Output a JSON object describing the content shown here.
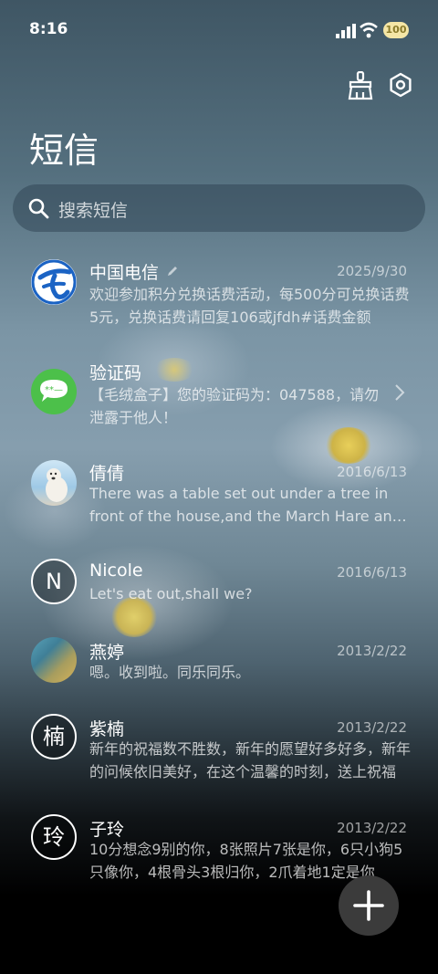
{
  "status": {
    "time": "8:16",
    "battery": "100"
  },
  "icons": {
    "clean": "broom-icon",
    "settings": "settings-icon",
    "search": "search-icon",
    "add": "plus-icon"
  },
  "header": {
    "title": "短信"
  },
  "search": {
    "placeholder": "搜索短信"
  },
  "colors": {
    "telecom": "#1b63c4",
    "verify": "#4cc04a",
    "fab": "#3b3b3b"
  },
  "conversations": [
    {
      "name": "中国电信",
      "date": "2025/9/30",
      "preview": "欢迎参加积分兑换话费活动，每500分可兑换话费5元，兑换话费请回复106或jfdh#话费金额",
      "avatar": "telecom-logo"
    },
    {
      "name": "验证码",
      "date": "",
      "preview": "【毛绒盒子】您的验证码为：047588，请勿泄露于他人！",
      "avatar": "chat-bubble-icon"
    },
    {
      "name": "倩倩",
      "date": "2016/6/13",
      "preview": "There was a table set out under a tree in front of the house,and the March Hare and the Hatter",
      "avatar": "polar-bear-photo"
    },
    {
      "name": "Nicole",
      "date": "2016/6/13",
      "preview": "Let's eat out,shall we?",
      "avatar_letter": "N"
    },
    {
      "name": "燕婷",
      "date": "2013/2/22",
      "preview": "嗯。收到啦。同乐同乐。",
      "avatar": "landscape-photo"
    },
    {
      "name": "紫楠",
      "date": "2013/2/22",
      "preview": "新年的祝福数不胜数，新年的愿望好多好多，新年的问候依旧美好，在这个温馨的时刻，送上祝福",
      "avatar_letter": "楠"
    },
    {
      "name": "子玲",
      "date": "2013/2/22",
      "preview": "10分想念9别的你，8张照片7张是你，6只小狗5只像你，4根骨头3根归你，2爪着地1定是你",
      "avatar_letter": "玲"
    }
  ]
}
